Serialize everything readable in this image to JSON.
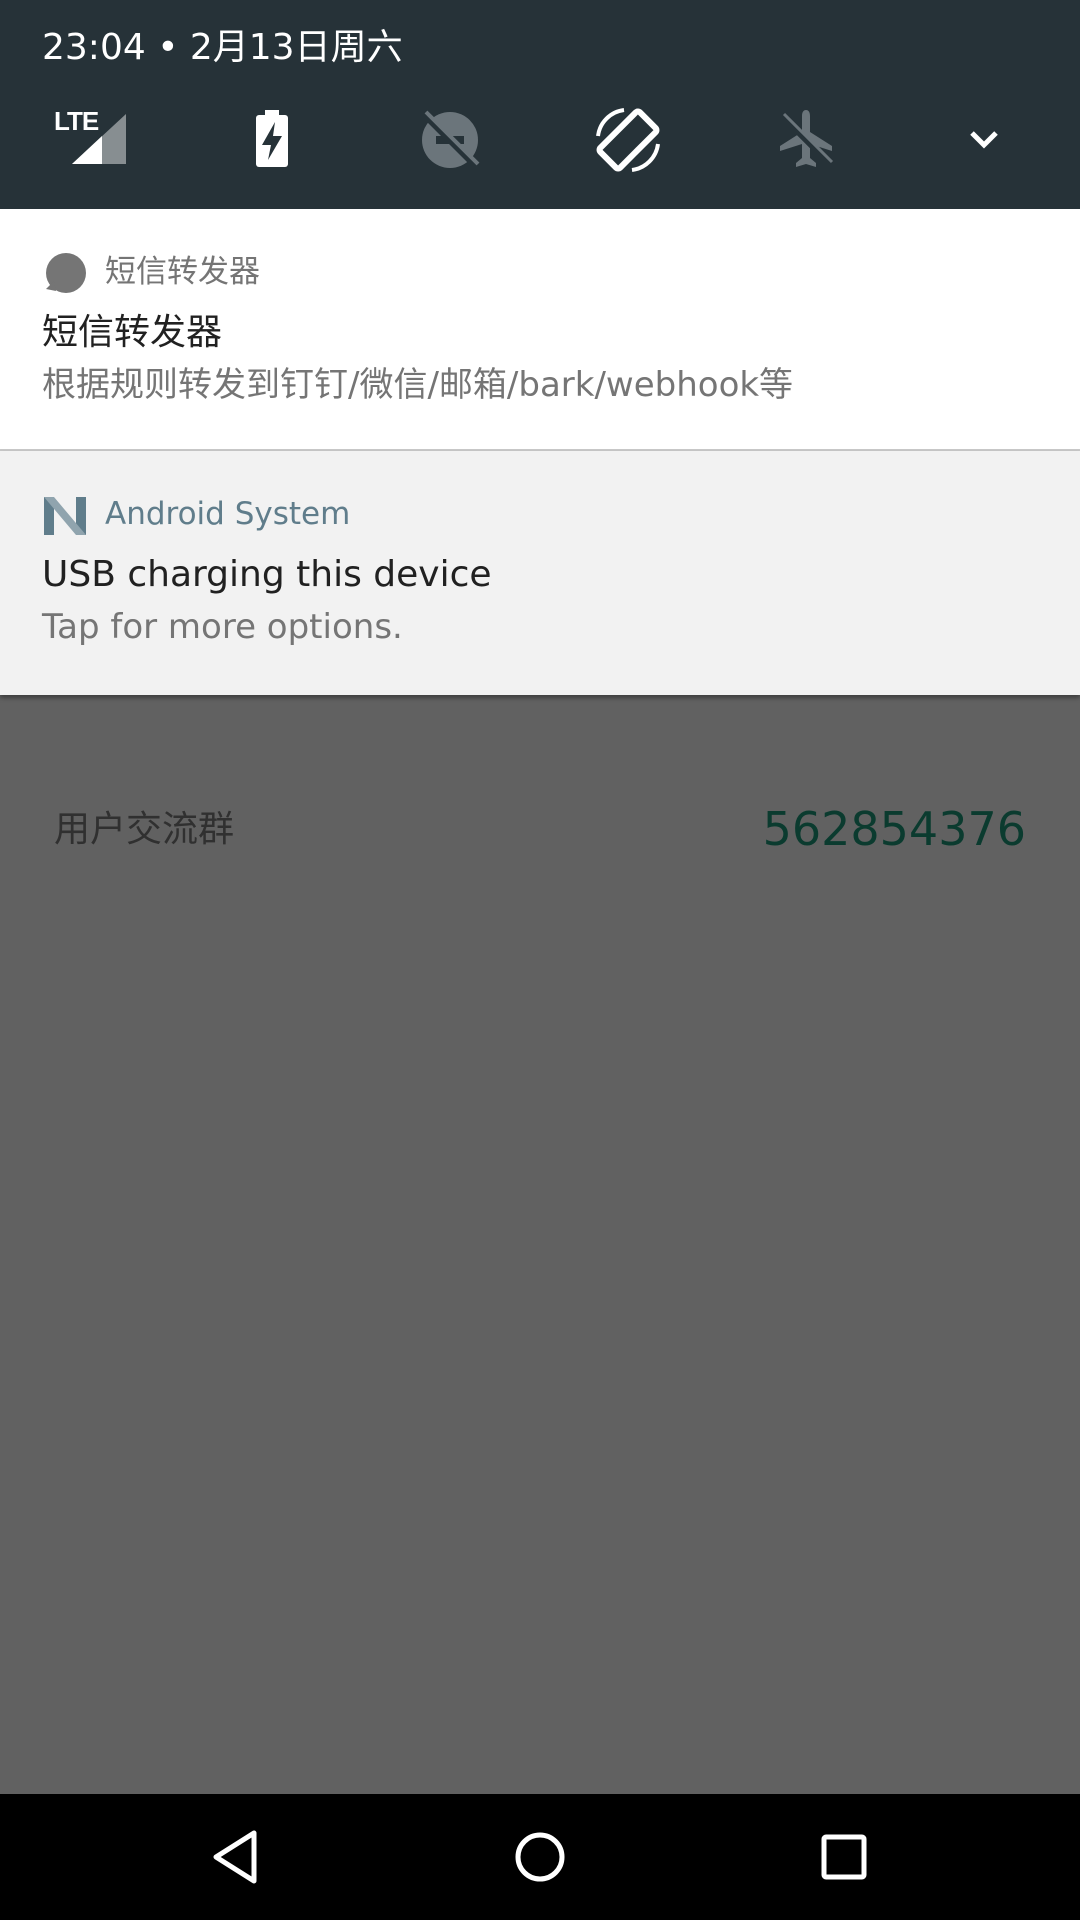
{
  "status": {
    "datetime": "23:04 • 2月13日周六"
  },
  "quick_settings": {
    "tiles": [
      {
        "icon": "lte-signal-icon",
        "label": "LTE"
      },
      {
        "icon": "battery-charging-icon"
      },
      {
        "icon": "data-saver-off-icon"
      },
      {
        "icon": "auto-rotate-icon"
      },
      {
        "icon": "airplane-mode-icon"
      },
      {
        "icon": "expand-chevron-icon"
      }
    ]
  },
  "notifications": [
    {
      "app_name": "短信转发器",
      "title": "短信转发器",
      "text": "根据规则转发到钉钉/微信/邮箱/bark/webhook等",
      "app_name_color": "#757575"
    },
    {
      "app_name": "Android System",
      "title": "USB charging this device",
      "text": "Tap for more options.",
      "app_name_color": "#607d8b"
    }
  ],
  "app_content": {
    "label": "用户交流群",
    "value": "562854376"
  },
  "nav": {
    "buttons": [
      {
        "icon": "back-icon"
      },
      {
        "icon": "home-icon"
      },
      {
        "icon": "recents-icon"
      }
    ]
  },
  "colors": {
    "header_bg": "#263238",
    "scrim": "#616161",
    "accent_teal": "#0b3b2f"
  }
}
